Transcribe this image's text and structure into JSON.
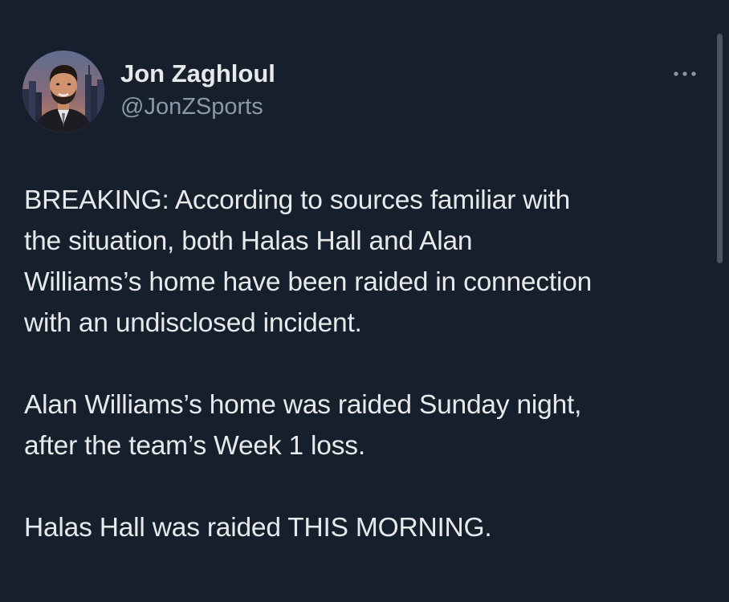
{
  "author": {
    "display_name": "Jon Zaghloul",
    "handle": "@JonZSports",
    "avatar_icon": "profile-photo"
  },
  "more_icon": "more-horizontal-icon",
  "tweet": {
    "paragraphs": [
      "BREAKING: According to sources familiar with\nthe situation, both Halas Hall and Alan\nWilliams’s home have been raided in connection\nwith an undisclosed incident.",
      "Alan Williams’s home was raided Sunday night,\nafter the team’s Week 1 loss.",
      "Halas Hall was raided THIS MORNING."
    ]
  },
  "colors": {
    "background": "#16202d",
    "text": "#e7e9ea",
    "secondary_text": "#8b98a5"
  }
}
